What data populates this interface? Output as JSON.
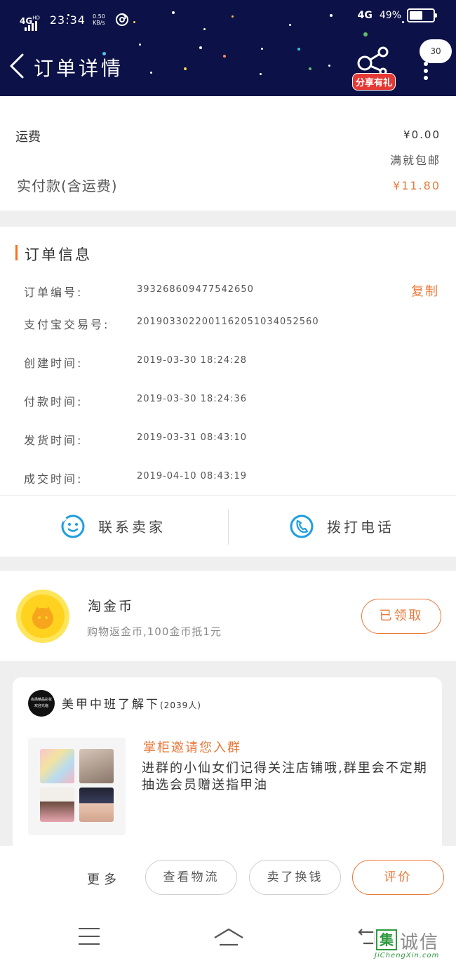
{
  "status_bar": {
    "network_left": "4G",
    "network_left_sub": "HD",
    "time": "23:34",
    "speed_value": "0.50",
    "speed_unit": "KB/s",
    "network_right": "4G",
    "battery": "49%"
  },
  "header": {
    "title": "订单详情",
    "share_label": "分享有礼",
    "bubble_count": "30"
  },
  "fee": {
    "shipping_label": "运费",
    "shipping_value": "¥0.00",
    "shipping_note": "满就包邮",
    "paid_label": "实付款(含运费)",
    "paid_value": "¥11.80"
  },
  "order_info": {
    "title": "订单信息",
    "copy_label": "复制",
    "rows": [
      {
        "key": "订单编号:",
        "value": "393268609477542650"
      },
      {
        "key": "支付宝交易号:",
        "value": "2019033022001162051034052560"
      },
      {
        "key": "创建时间:",
        "value": "2019-03-30 18:24:28"
      },
      {
        "key": "付款时间:",
        "value": "2019-03-30 18:24:36"
      },
      {
        "key": "发货时间:",
        "value": "2019-03-31 08:43:10"
      },
      {
        "key": "成交时间:",
        "value": "2019-04-10 08:43:19"
      }
    ],
    "contact_seller": "联系卖家",
    "call_phone": "拨打电话"
  },
  "gold_coin": {
    "title": "淘金币",
    "desc": "购物返金币,100金币抵1元",
    "button": "已领取"
  },
  "group": {
    "avatar_text_1": "名扬精品彩妆",
    "avatar_text_2": "欢迎光临",
    "name": "美甲中班了解下",
    "count": "(2039人)",
    "invite": "掌柜邀请您入群",
    "desc": "进群的小仙女们记得关注店铺哦,群里会不定期抽选会员赠送指甲油"
  },
  "actions": {
    "more": "更多",
    "logistics": "查看物流",
    "sell": "卖了换钱",
    "review": "评价"
  },
  "watermark": {
    "box": "集",
    "text": "诚信",
    "url": "JiChengXin.com"
  },
  "colors": {
    "header_bg": "#0c1247",
    "accent_orange": "#e8793a",
    "contact_blue": "#1e9ee0",
    "coin_yellow": "#ffd21f"
  }
}
